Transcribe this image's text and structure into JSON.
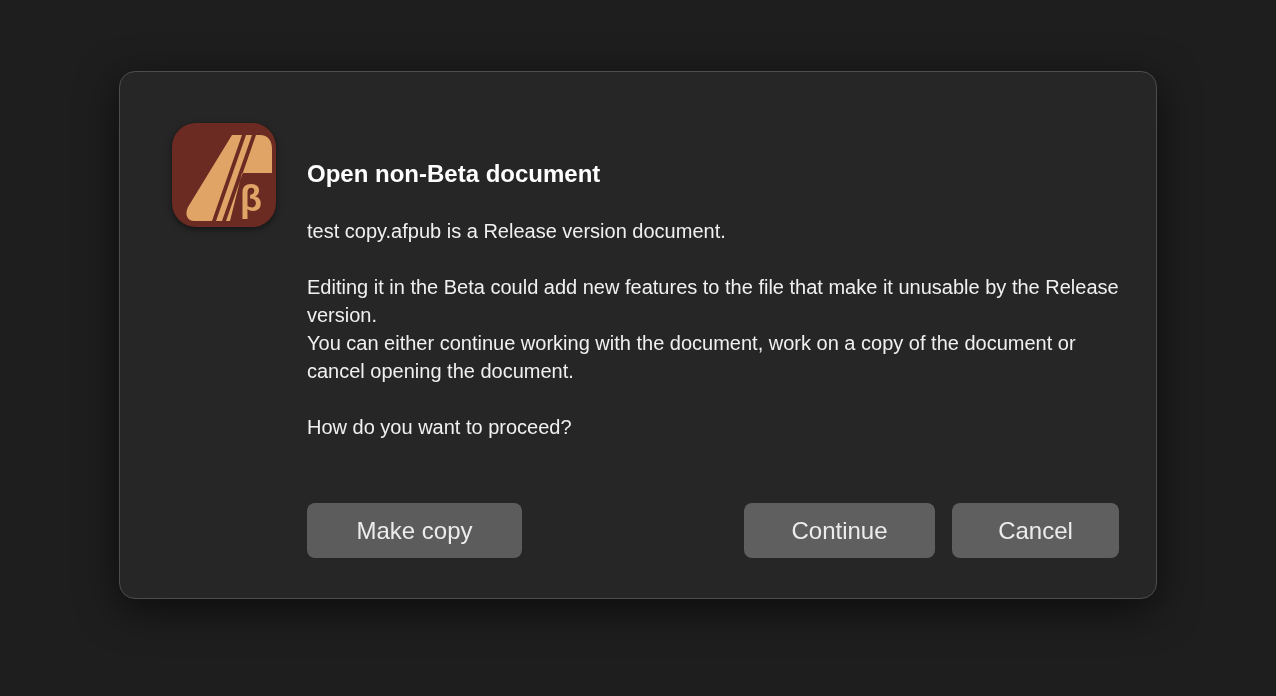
{
  "dialog": {
    "logo_letter": "β",
    "title": "Open non-Beta document",
    "message": [
      [
        "test copy.afpub is a Release version document."
      ],
      [
        "Editing it in the Beta could add new features to the file that make it unusable by the Release version.",
        "You can either continue working with the document, work on a copy of the document or cancel opening the document."
      ],
      [
        "How do you want to proceed?"
      ]
    ],
    "buttons": [
      {
        "label": "Make copy",
        "kind": "secondary"
      },
      {
        "label": "Continue",
        "kind": "primary"
      },
      {
        "label": "Cancel",
        "kind": "primary"
      }
    ]
  }
}
